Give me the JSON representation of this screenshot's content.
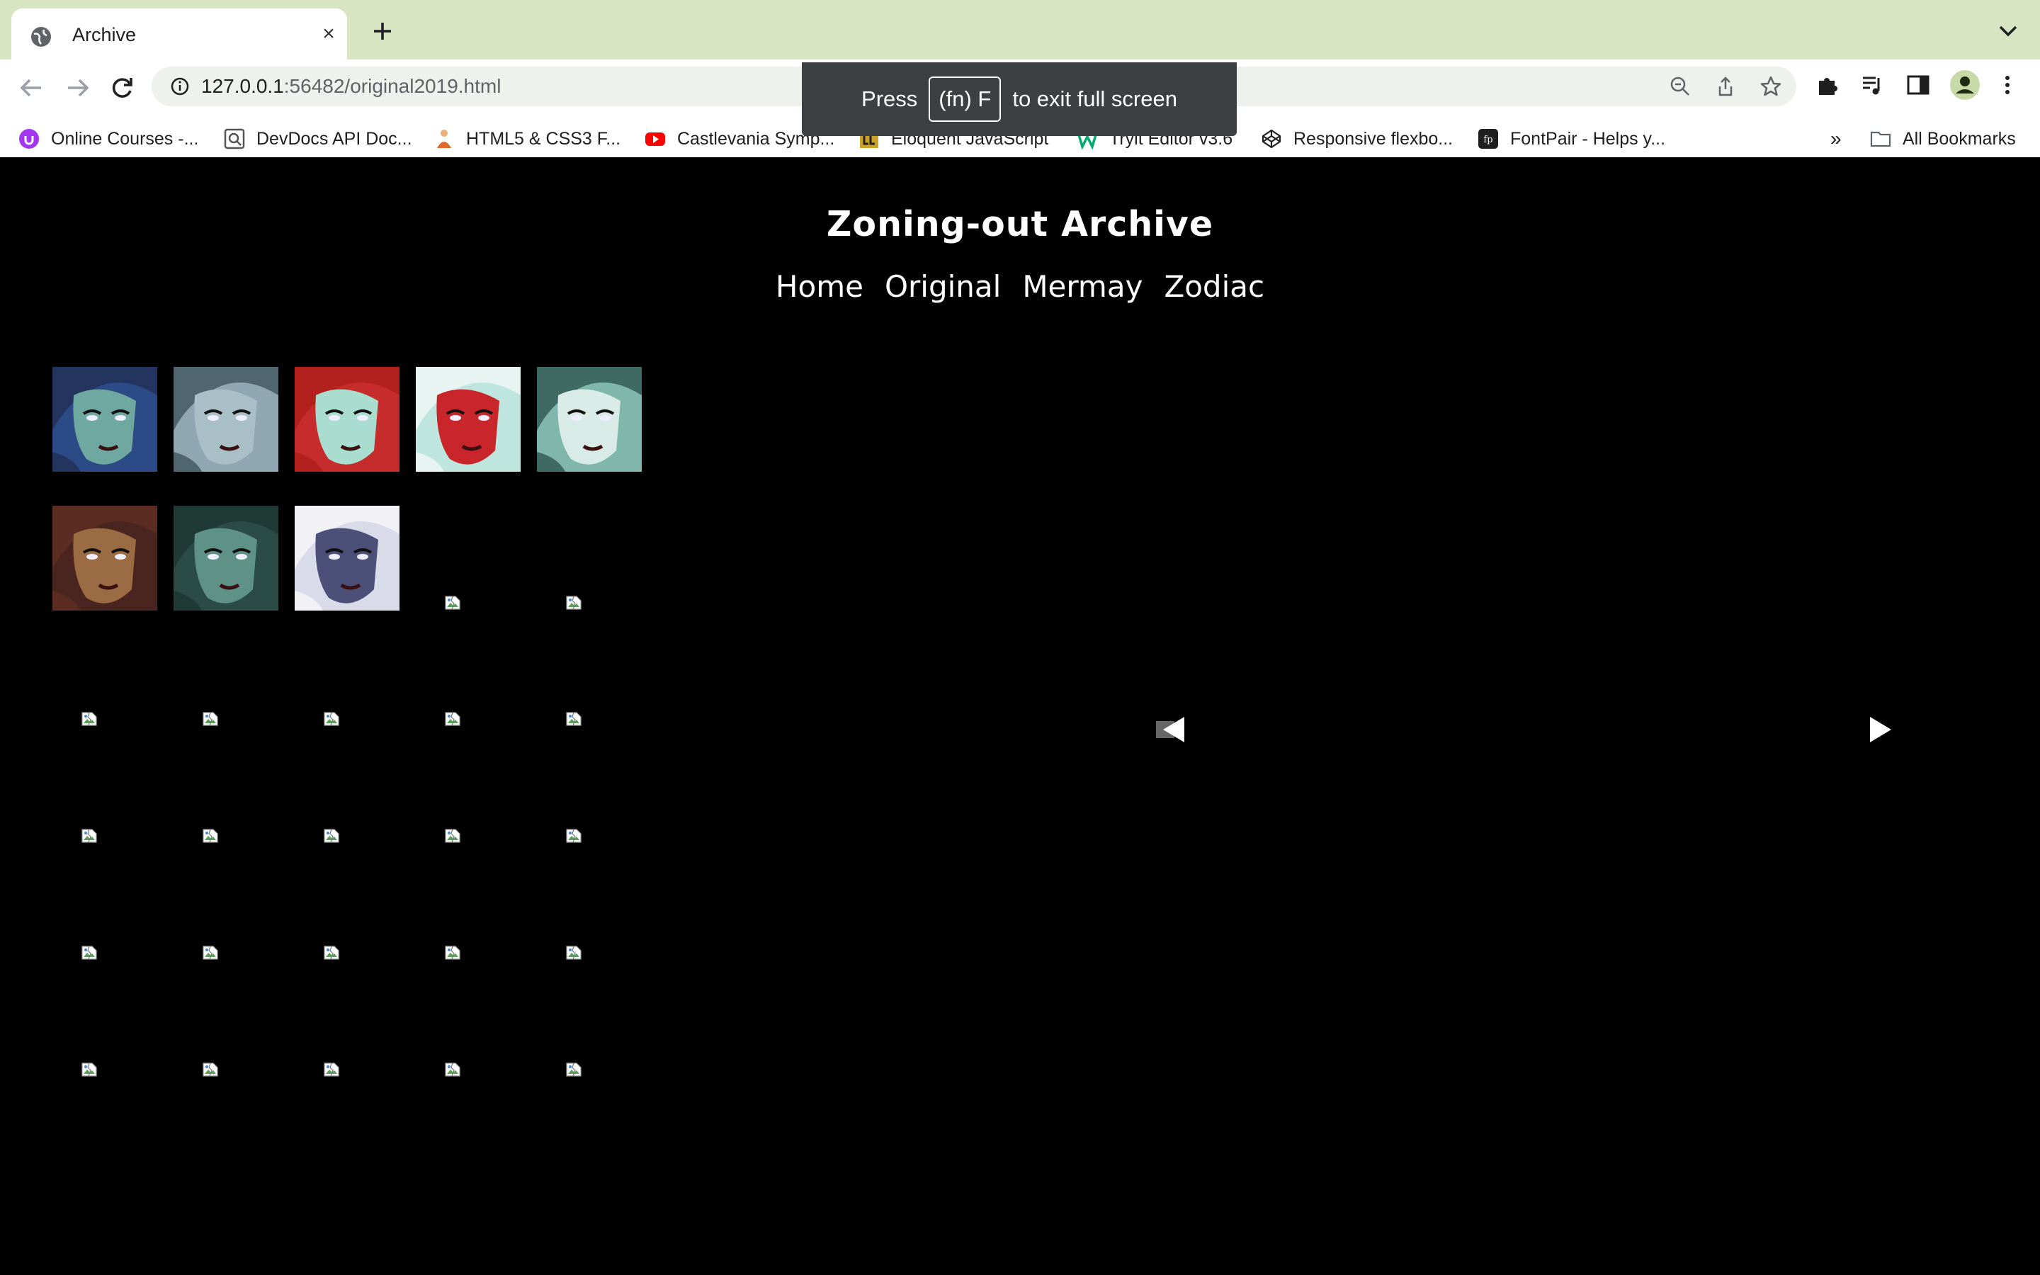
{
  "tab": {
    "title": "Archive"
  },
  "address_bar": {
    "host": "127.0.0.1",
    "path": ":56482/original2019.html"
  },
  "bookmarks": [
    {
      "label": "Online Courses -...",
      "icon": "udemy-icon"
    },
    {
      "label": "DevDocs API Doc...",
      "icon": "devdocs-icon"
    },
    {
      "label": "HTML5 & CSS3 F...",
      "icon": "html5-css3-icon"
    },
    {
      "label": "Castlevania Symp...",
      "icon": "youtube-icon"
    },
    {
      "label": "Eloquent JavaScript",
      "icon": "eloquent-js-icon"
    },
    {
      "label": "Tryit Editor v3.6",
      "icon": "w3schools-icon"
    },
    {
      "label": "Responsive flexbo...",
      "icon": "codepen-icon"
    },
    {
      "label": "FontPair - Helps y...",
      "icon": "fontpair-icon"
    }
  ],
  "bookmarks_overflow": "»",
  "all_bookmarks": "All Bookmarks",
  "fullscreen_toast": {
    "prefix": "Press",
    "key": "(fn) F",
    "suffix": "to exit full screen"
  },
  "site": {
    "title": "Zoning-out Archive",
    "nav": [
      "Home",
      "Original",
      "Mermay",
      "Zodiac"
    ]
  },
  "gallery": {
    "loaded_thumbnails": [
      {
        "name": "blue-faced-woman-with-gem",
        "bg": "#2c4a86",
        "skin": "#6fa8a0",
        "hair": "#23345f"
      },
      {
        "name": "gray-haired-woman",
        "bg": "#8fa6b3",
        "skin": "#a8bfc6",
        "hair": "#4f6671"
      },
      {
        "name": "red-haired-woman",
        "bg": "#c72c2c",
        "skin": "#a8ddd0",
        "hair": "#b3211d"
      },
      {
        "name": "red-skinned-horned-woman",
        "bg": "#bfe6de",
        "skin": "#c8262a",
        "hair": "#e8f4f1"
      },
      {
        "name": "pale-woman-with-tiara",
        "bg": "#7fb7ac",
        "skin": "#d8ebe6",
        "hair": "#3f6a64"
      },
      {
        "name": "freckled-brown-woman",
        "bg": "#4a2520",
        "skin": "#9b6b43",
        "hair": "#5b2d22"
      },
      {
        "name": "teal-elf-woman",
        "bg": "#2a4b46",
        "skin": "#5e9287",
        "hair": "#1f3a35"
      },
      {
        "name": "white-haired-starry-woman",
        "bg": "#d9dbe8",
        "skin": "#4c4f77",
        "hair": "#f1f1f6"
      }
    ],
    "broken_image_count": 22
  },
  "slideshow": {
    "prev_icon": "triangle-left-icon",
    "next_icon": "triangle-right-icon"
  }
}
